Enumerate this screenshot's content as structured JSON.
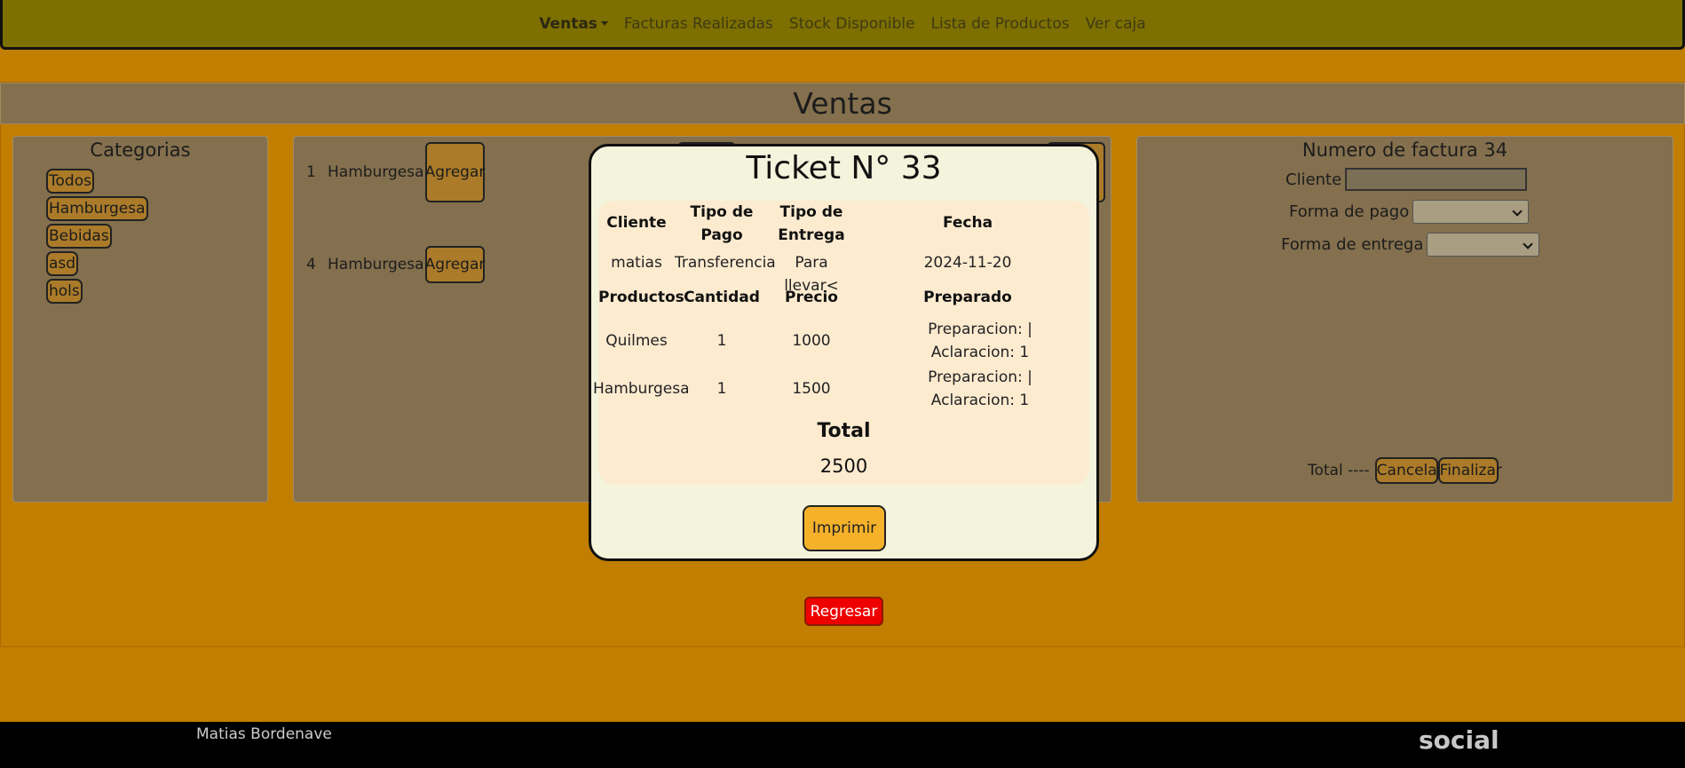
{
  "nav": {
    "items": [
      {
        "label": "Ventas",
        "active": true
      },
      {
        "label": "Facturas Realizadas"
      },
      {
        "label": "Stock Disponible"
      },
      {
        "label": "Lista de Productos"
      },
      {
        "label": "Ver caja"
      }
    ]
  },
  "page_title": "Ventas",
  "categories": {
    "title": "Categorias",
    "items": [
      "Todos",
      "Hamburgesa",
      "Bebidas",
      "asd",
      "hols"
    ]
  },
  "products": {
    "rows": [
      {
        "num": "1",
        "name": "Hamburgesa",
        "button": "Agregar"
      },
      {
        "num": "4",
        "name": "Hamburgesa",
        "button": "Agregar"
      }
    ]
  },
  "invoice": {
    "title": "Numero de factura 34",
    "cliente_label": "Cliente",
    "cliente_value": "",
    "forma_pago_label": "Forma de pago",
    "forma_entrega_label": "Forma de entrega",
    "total_label": "Total ----",
    "cancel_label": "Cancelar",
    "finish_label": "Finalizar"
  },
  "back_button": "Regresar",
  "footer": {
    "author": "Matias Bordenave",
    "social": "social"
  },
  "modal": {
    "title": "Ticket N° 33",
    "headers": {
      "cliente": "Cliente",
      "tipo_pago": "Tipo de Pago",
      "tipo_entrega": "Tipo de Entrega",
      "fecha": "Fecha"
    },
    "values": {
      "cliente": "matias",
      "tipo_pago": "Transferencia",
      "tipo_entrega": "Para llevar<",
      "fecha": "2024-11-20"
    },
    "product_headers": {
      "productos": "Productos",
      "cantidad": "Cantidad",
      "precio": "Precio",
      "preparado": "Preparado"
    },
    "lines": [
      {
        "producto": "Quilmes",
        "cantidad": "1",
        "precio": "1000",
        "preparado": "Preparacion: | Aclaracion: 1"
      },
      {
        "producto": "Hamburgesa",
        "cantidad": "1",
        "precio": "1500",
        "preparado": "Preparacion: | Aclaracion: 1"
      }
    ],
    "total_label": "Total",
    "total_value": "2500",
    "print_button": "Imprimir"
  }
}
